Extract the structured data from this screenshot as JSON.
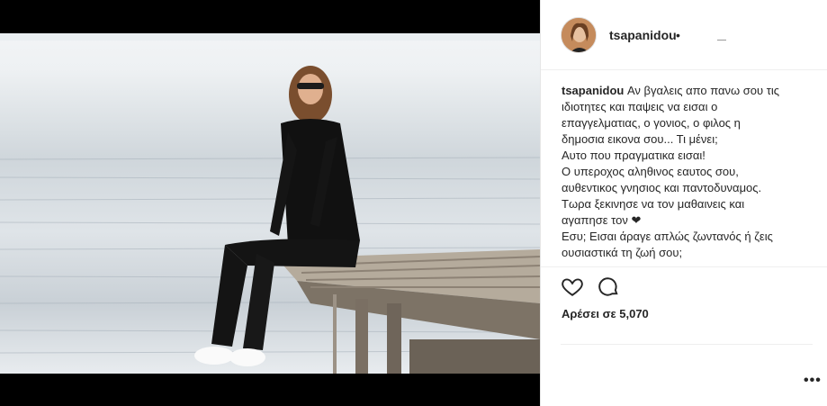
{
  "post": {
    "username": "tsapanidou",
    "dot": "•",
    "caption": {
      "username": "tsapanidou",
      "lines": [
        "Αν βγαλεις απο πανω σου τις",
        "ιδιοτητες και παψεις να εισαι ο",
        "επαγγελματιας, ο γονιος, ο φιλος η",
        "δημοσια εικονα σου... Τι μένει;",
        "Αυτο που πραγματικα εισαι!",
        "Ο υπεροχος αληθινος εαυτος σου,",
        "αυθεντικος γνησιος και παντοδυναμος.",
        "Τωρα ξεκινησε να τον μαθαινεις και",
        "αγαπησε τον ❤",
        "Εσυ; Εισαι άραγε απλώς ζωντανός ή ζεις",
        "ουσιαστικά τη ζωή σου;"
      ]
    },
    "likes_text": "Αρέσει σε 5,070",
    "more_label": "•••"
  },
  "icons": {
    "like": "heart-outline-icon",
    "comment": "comment-bubble-icon",
    "more": "more-options-icon"
  }
}
